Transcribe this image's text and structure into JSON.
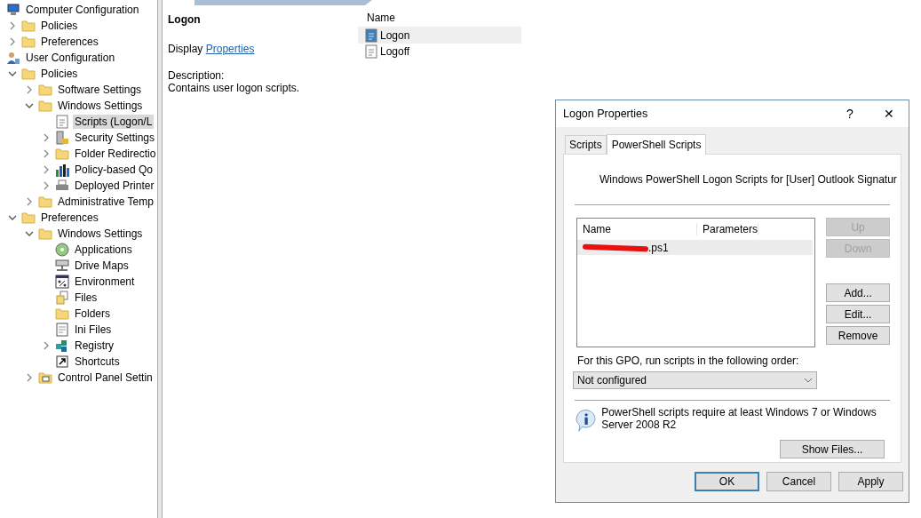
{
  "tree": [
    {
      "label": "Computer Configuration",
      "kind": "computer",
      "selected": false,
      "children": [
        {
          "label": "Policies",
          "kind": "folder",
          "expanded": false,
          "selected": false
        },
        {
          "label": "Preferences",
          "kind": "folder",
          "expanded": false,
          "selected": false
        }
      ]
    },
    {
      "label": "User Configuration",
      "kind": "user",
      "selected": false,
      "children": [
        {
          "label": "Policies",
          "kind": "folder",
          "expanded": true,
          "selected": false,
          "children": [
            {
              "label": "Software Settings",
              "kind": "folder",
              "expanded": false,
              "selected": false
            },
            {
              "label": "Windows Settings",
              "kind": "folder",
              "expanded": true,
              "selected": false,
              "children": [
                {
                  "label": "Scripts (Logon/L",
                  "kind": "script",
                  "selected": true
                },
                {
                  "label": "Security Settings",
                  "kind": "security",
                  "expanded": false,
                  "selected": false
                },
                {
                  "label": "Folder Redirectio",
                  "kind": "folder",
                  "expanded": false,
                  "selected": false
                },
                {
                  "label": "Policy-based Qo",
                  "kind": "chart",
                  "expanded": false,
                  "selected": false
                },
                {
                  "label": "Deployed Printer",
                  "kind": "printer",
                  "expanded": false,
                  "selected": false
                }
              ]
            },
            {
              "label": "Administrative Temp",
              "kind": "folder",
              "expanded": false,
              "selected": false
            }
          ]
        },
        {
          "label": "Preferences",
          "kind": "folder",
          "expanded": true,
          "selected": false,
          "children": [
            {
              "label": "Windows Settings",
              "kind": "folder",
              "expanded": true,
              "selected": false,
              "children": [
                {
                  "label": "Applications",
                  "kind": "disc",
                  "selected": false
                },
                {
                  "label": "Drive Maps",
                  "kind": "drive",
                  "selected": false
                },
                {
                  "label": "Environment",
                  "kind": "percent",
                  "selected": false
                },
                {
                  "label": "Files",
                  "kind": "files",
                  "selected": false
                },
                {
                  "label": "Folders",
                  "kind": "folder",
                  "selected": false
                },
                {
                  "label": "Ini Files",
                  "kind": "doc",
                  "selected": false
                },
                {
                  "label": "Registry",
                  "kind": "cubes",
                  "expanded": false,
                  "selected": false
                },
                {
                  "label": "Shortcuts",
                  "kind": "shortcut",
                  "selected": false
                }
              ]
            },
            {
              "label": "Control Panel Settin",
              "kind": "panel",
              "expanded": false,
              "selected": false
            }
          ]
        }
      ]
    }
  ],
  "details": {
    "title": "Logon",
    "display_label": "Display",
    "display_link": "Properties",
    "description_label": "Description:",
    "description": "Contains user logon scripts."
  },
  "list": {
    "column": "Name",
    "items": [
      {
        "label": "Logon",
        "kind": "logon",
        "selected": true
      },
      {
        "label": "Logoff",
        "kind": "script",
        "selected": false
      }
    ]
  },
  "dialog": {
    "title": "Logon Properties",
    "help": "?",
    "close": "✕",
    "tabs": [
      {
        "label": "Scripts",
        "selected": false
      },
      {
        "label": "PowerShell Scripts",
        "selected": true
      }
    ],
    "heading": "Windows PowerShell Logon Scripts for [User] Outlook Signatur",
    "table": {
      "columns": [
        "Name",
        "Parameters"
      ],
      "rows": [
        {
          "name": ".ps1",
          "redacted": true,
          "selected": true
        }
      ]
    },
    "side_buttons": [
      {
        "label": "Up",
        "disabled": true
      },
      {
        "label": "Down",
        "disabled": true
      },
      {
        "label": "Add...",
        "disabled": false
      },
      {
        "label": "Edit...",
        "disabled": false
      },
      {
        "label": "Remove",
        "disabled": false
      }
    ],
    "order_label": "For this GPO, run scripts in the following order:",
    "order_value": "Not configured",
    "info": "PowerShell scripts require at least Windows 7 or Windows Server 2008 R2",
    "show_files": "Show Files...",
    "buttons": [
      {
        "label": "OK",
        "default": true
      },
      {
        "label": "Cancel",
        "default": false
      },
      {
        "label": "Apply",
        "default": false
      }
    ]
  }
}
